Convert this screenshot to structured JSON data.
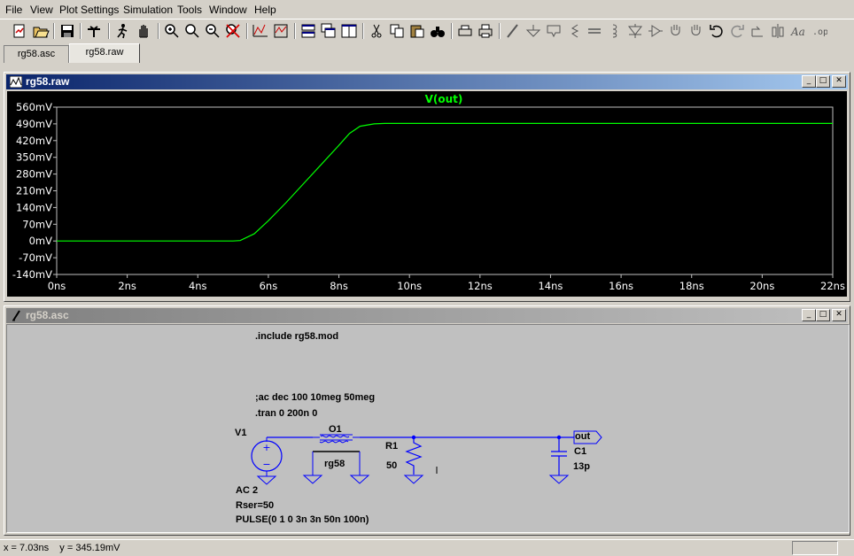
{
  "menu": [
    "File",
    "View",
    "Plot Settings",
    "Simulation",
    "Tools",
    "Window",
    "Help"
  ],
  "toolbar_icons": [
    "new-schematic-icon",
    "open-icon",
    "save-icon",
    "control-panel-icon",
    "run-icon",
    "halt-icon",
    "zoom-in-icon",
    "zoom-area-icon",
    "zoom-out-icon",
    "zoom-cancel-icon",
    "autorange-icon",
    "autorange-y-icon",
    "tile-horizontal-icon",
    "cascade-icon",
    "tile-vertical-icon",
    "cut-icon",
    "copy-icon",
    "paste-icon",
    "find-icon",
    "print-setup-icon",
    "print-icon",
    "wire-icon",
    "ground-icon",
    "label-net-icon",
    "resistor-icon",
    "capacitor-icon",
    "inductor-icon",
    "diode-icon",
    "component-icon",
    "move-icon",
    "drag-icon",
    "undo-icon",
    "redo-icon",
    "rotate-icon",
    "mirror-icon",
    "text-icon",
    "spice-directive-icon"
  ],
  "tabs": [
    {
      "label": "rg58.asc"
    },
    {
      "label": "rg58.raw"
    }
  ],
  "plot_window": {
    "title": "rg58.raw"
  },
  "schematic_window": {
    "title": "rg58.asc"
  },
  "chart_data": {
    "type": "line",
    "title": "",
    "series": [
      {
        "name": "V(out)",
        "color": "#00ff00",
        "x": [
          0,
          5,
          5.2,
          5.6,
          6,
          6.5,
          7,
          7.5,
          8,
          8.3,
          8.6,
          9,
          9.3,
          10,
          22
        ],
        "y": [
          0,
          0,
          2,
          30,
          85,
          160,
          240,
          320,
          400,
          450,
          480,
          490,
          492,
          492,
          492
        ]
      }
    ],
    "xlabel": "",
    "ylabel": "",
    "xticks": [
      "0ns",
      "2ns",
      "4ns",
      "6ns",
      "8ns",
      "10ns",
      "12ns",
      "14ns",
      "16ns",
      "18ns",
      "20ns",
      "22ns"
    ],
    "xtick_values": [
      0,
      2,
      4,
      6,
      8,
      10,
      12,
      14,
      16,
      18,
      20,
      22
    ],
    "yticks": [
      "560mV",
      "490mV",
      "420mV",
      "350mV",
      "280mV",
      "210mV",
      "140mV",
      "70mV",
      "0mV",
      "-70mV",
      "-140mV"
    ],
    "ytick_values": [
      560,
      490,
      420,
      350,
      280,
      210,
      140,
      70,
      0,
      -70,
      -140
    ],
    "xlim": [
      0,
      22
    ],
    "ylim": [
      -140,
      560
    ],
    "grid": false
  },
  "schematic": {
    "directive_include": ".include rg58.mod",
    "directive_ac": ";ac dec 100 10meg 50meg",
    "directive_tran": ".tran 0 200n 0",
    "v1_name": "V1",
    "v1_ac": "AC 2",
    "v1_rser": "Rser=50",
    "v1_pulse": "PULSE(0 1 0 3n 3n 50n 100n)",
    "o1_name": "O1",
    "o1_model": "rg58",
    "r1_name": "R1",
    "r1_value": "50",
    "c1_name": "C1",
    "c1_value": "13p",
    "net_label": "out"
  },
  "status": {
    "text": "x = 7.03ns    y = 345.19mV"
  }
}
